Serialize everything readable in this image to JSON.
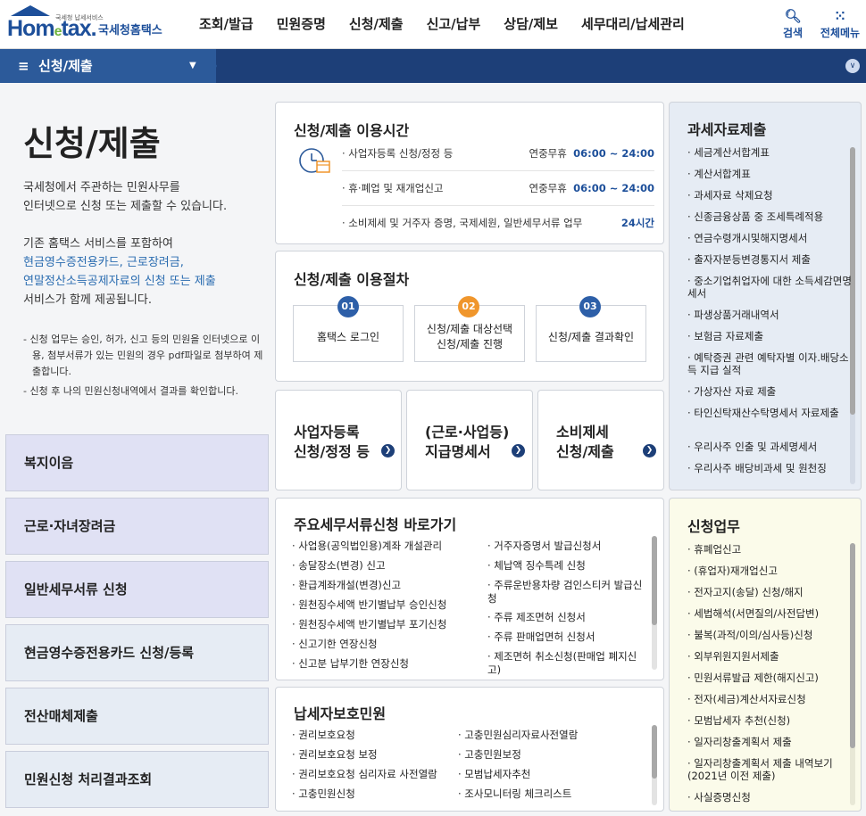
{
  "header": {
    "logo_sub": "국세청 납세서비스",
    "logo_home": "Hom",
    "logo_e": "e",
    "logo_tax": "tax.",
    "logo_kor": "국세청홈택스",
    "nav": [
      "조회/발급",
      "민원증명",
      "신청/제출",
      "신고/납부",
      "상담/제보",
      "세무대리/납세관리"
    ],
    "search_label": "검색",
    "menu_label": "전체메뉴"
  },
  "subbar": {
    "label": "신청/제출"
  },
  "left": {
    "title": "신청/제출",
    "desc1": "국세청에서 주관하는 민원사무를",
    "desc2": "인터넷으로 신청 또는 제출할 수 있습니다.",
    "desc3": "기존 홈택스 서비스를 포함하여",
    "desc4": "현금영수증전용카드, 근로장려금,",
    "desc5": "연말정산소득공제자료의 신청 또는 제출",
    "desc6": "서비스가 함께 제공됩니다.",
    "note1": "- 신청 업무는 승인, 허가, 신고 등의 민원을 인터넷으로 이용, 첨부서류가 있는 민원의 경우 pdf파일로 첨부하여 제출합니다.",
    "note2": "- 신청 후 나의 민원신청내역에서 결과를 확인합니다.",
    "menus": [
      "복지이음",
      "근로·자녀장려금",
      "일반세무서류 신청",
      "현금영수증전용카드 신청/등록",
      "전산매체제출",
      "민원신청 처리결과조회"
    ]
  },
  "hours": {
    "title": "신청/제출 이용시간",
    "rows": [
      {
        "label": "· 사업자등록 신청/정정 등",
        "days": "연중무휴",
        "time": "06:00 ~ 24:00"
      },
      {
        "label": "· 휴·폐업 및 재개업신고",
        "days": "연중무휴",
        "time": "06:00 ~ 24:00"
      },
      {
        "label": "· 소비제세 및 거주자 증명, 국제세원, 일반세무서류 업무",
        "days": "",
        "time": "24시간"
      }
    ]
  },
  "procedure": {
    "title": "신청/제출 이용절차",
    "steps": [
      {
        "num": "01",
        "line1": "홈택스 로그인",
        "line2": ""
      },
      {
        "num": "02",
        "line1": "신청/제출 대상선택",
        "line2": "신청/제출 진행"
      },
      {
        "num": "03",
        "line1": "신청/제출 결과확인",
        "line2": ""
      }
    ]
  },
  "tiles": [
    {
      "line1": "사업자등록",
      "line2": "신청/정정 등"
    },
    {
      "line1": "(근로·사업등)",
      "line2": "지급명세서"
    },
    {
      "line1": "소비제세",
      "line2": "신청/제출"
    }
  ],
  "shortcuts": {
    "title": "주요세무서류신청 바로가기",
    "left": [
      "· 사업용(공익법인용)계좌 개설관리",
      "· 송달장소(변경) 신고",
      "· 환급계좌개설(변경)신고",
      "· 원천징수세액 반기별납부 승인신청",
      "· 원천징수세액 반기별납부 포기신청",
      "· 신고기한 연장신청",
      "· 신고분 납부기한 연장신청"
    ],
    "right": [
      "· 거주자증명서 발급신청서",
      "· 체납액 징수특례 신청",
      "· 주류운반용차량 검인스티커 발급신청",
      "· 주류 제조면허 신청서",
      "· 주류 판매업면허 신청서",
      "· 제조면허 취소신청(판매업 폐지신고)"
    ]
  },
  "protection": {
    "title": "납세자보호민원",
    "left": [
      "· 권리보호요청",
      "· 권리보호요청 보정",
      "· 권리보호요청 심리자료 사전열람",
      "· 고충민원신청"
    ],
    "right": [
      "· 고충민원심리자료사전열람",
      "· 고충민원보정",
      "· 모범납세자추천",
      "· 조사모니터링 체크리스트"
    ]
  },
  "taxdata": {
    "title": "과세자료제출",
    "items": [
      "· 세금계산서합계표",
      "· 계산서합계표",
      "· 과세자료 삭제요청",
      "· 신종금융상품 중 조세특례적용",
      "· 연금수령개시및해지명세서",
      "· 출자자분등변경통지서 제출",
      "· 중소기업취업자에 대한 소득세감면명세서",
      "· 파생상품거래내역서",
      "· 보험금 자료제출",
      "· 예탁증권 관련 예탁자별 이자.배당소득 지급 실적",
      "· 가상자산 자료 제출",
      "· 타인신탁재산수탁명세서 자료제출",
      "· 우리사주 인출 및 과세명세서",
      "· 우리사주 배당비과세 및 원천징"
    ]
  },
  "apply": {
    "title": "신청업무",
    "items": [
      "· 휴폐업신고",
      "· (휴업자)재개업신고",
      "· 전자고지(송달) 신청/해지",
      "· 세법해석(서면질의/사전답변)",
      "· 불복(과적/이의/심사등)신청",
      "· 외부위원지원서제출",
      "· 민원서류발급 제한(해지신고)",
      "· 전자(세금)계산서자료신청",
      "· 모범납세자 추천(신청)",
      "· 일자리창출계획서 제출",
      "· 일자리창출계획서 제출 내역보기(2021년 이전 제출)",
      "· 사실증명신청"
    ]
  },
  "colors": {
    "brand": "#1d4f9a",
    "subbar": "#1d3f78",
    "step1": "#2d5fa8",
    "step2": "#f0962c",
    "lavender": "#e0e1f4",
    "lightblue": "#e6ecf4",
    "cream": "#fbfbea"
  }
}
